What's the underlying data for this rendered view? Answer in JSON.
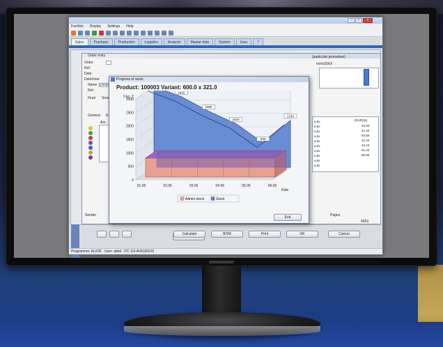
{
  "app": {
    "menu": [
      "Fachbio",
      "Display",
      "Settings",
      "Help",
      "?"
    ],
    "tabs": [
      "Sales",
      "Purchase",
      "Production",
      "Logistics",
      "Analysis",
      "Master data",
      "System",
      "User",
      "?"
    ],
    "status_text": "Programme: AL/OR · User: abbil · PC: E5-AVEUROXI"
  },
  "order_window": {
    "title": "Order entry",
    "labels": [
      "Order",
      "Ref.",
      "Date",
      "Date/hour",
      "Name",
      "Ref.",
      "Final"
    ],
    "name_value": "Lnnunnnn",
    "final_value": "Snnnn",
    "right_header": "(particular procedure)",
    "right_subheader": "m/m/20XX",
    "subtabs": [
      "General",
      "A"
    ],
    "grid_headers": [
      "Am.",
      "(EUR)Qy"
    ],
    "grid_numbers": [
      "45.00",
      "41.20",
      "83.56",
      "41.20",
      "43.20",
      "91.20",
      "65.95"
    ],
    "grid_codes": [
      "a.5x",
      "a.5x",
      "a.5x",
      "a.5x",
      "a.5x",
      "a.5x",
      "a.5x",
      "a.8x",
      "a.8x",
      "a.8x"
    ],
    "bottom_left": "Sender",
    "pages_label": "Pages",
    "pages_value": "4563",
    "buttons": [
      "Calculate",
      "BOM",
      "Print",
      "OK",
      "Cancel"
    ]
  },
  "dialog": {
    "title": "Progress of stock",
    "heading": "Product: 100003  Variant: 600.0 x 321.0",
    "end_button": "End"
  },
  "chart_data": {
    "type": "area",
    "title": "Product: 100003  Variant: 600.0 x 321.0",
    "ylabel": "Cen. 2",
    "xlabel": "Date",
    "y_ticks": [
      0,
      500,
      1000,
      1500,
      2000,
      2500,
      3000
    ],
    "ylim": [
      0,
      3000
    ],
    "x_ticks": [
      "01.06",
      "02.06",
      "03.06",
      "04.06",
      "05.06",
      "06.06"
    ],
    "grid": true,
    "legend_position": "bottom",
    "series": [
      {
        "name": "Admin stock",
        "color": "#e8a090",
        "values": [
          700,
          700,
          700,
          700,
          700,
          700
        ]
      },
      {
        "name": "Stock",
        "color": "#5a82d0",
        "values": [
          3000,
          2620,
          2080,
          1620,
          900,
          1740
        ]
      }
    ],
    "point_labels": [
      "3000",
      "2620",
      "2080",
      "1620",
      "900",
      "1740"
    ]
  },
  "colors": {
    "accent": "#2e64c8",
    "stock": "#5a82d0",
    "admin_stock": "#e8a090",
    "overlap": "#7a5ab0"
  }
}
